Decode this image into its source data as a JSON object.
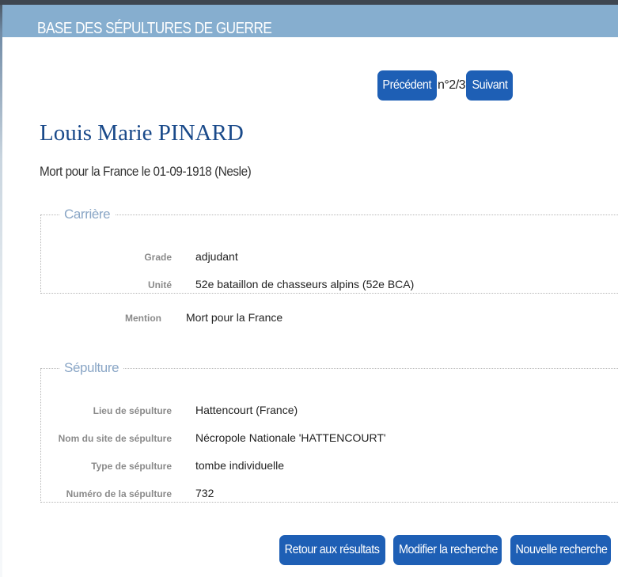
{
  "header": {
    "title": "BASE DES SÉPULTURES DE GUERRE"
  },
  "pager": {
    "prev_label": "Précédent",
    "count": "n°2/3",
    "next_label": "Suivant"
  },
  "person": {
    "name": "Louis Marie PINARD",
    "death_info": "Mort pour la France le 01-09-1918 (Nesle)"
  },
  "carriere": {
    "legend": "Carrière",
    "fields": [
      {
        "label": "Grade",
        "value": "adjudant"
      },
      {
        "label": "Unité",
        "value": "52e bataillon de chasseurs alpins (52e BCA)"
      }
    ]
  },
  "mention": {
    "label": "Mention",
    "value": "Mort pour la France"
  },
  "sepulture": {
    "legend": "Sépulture",
    "fields": [
      {
        "label": "Lieu de sépulture",
        "value": "Hattencourt (France)"
      },
      {
        "label": "Nom du site de sépulture",
        "value": "Nécropole Nationale 'HATTENCOURT'"
      },
      {
        "label": "Type de sépulture",
        "value": "tombe individuelle"
      },
      {
        "label": "Numéro de la sépulture",
        "value": "732"
      }
    ]
  },
  "actions": {
    "retour_label": "Retour aux résultats",
    "modifier_label": "Modifier la recherche",
    "nouvelle_label": "Nouvelle recherche"
  },
  "colors": {
    "header_bg": "#86aecf",
    "button_bg": "#1e5fb5",
    "name_color": "#1a4a8a",
    "legend_color": "#8aa6c6"
  }
}
